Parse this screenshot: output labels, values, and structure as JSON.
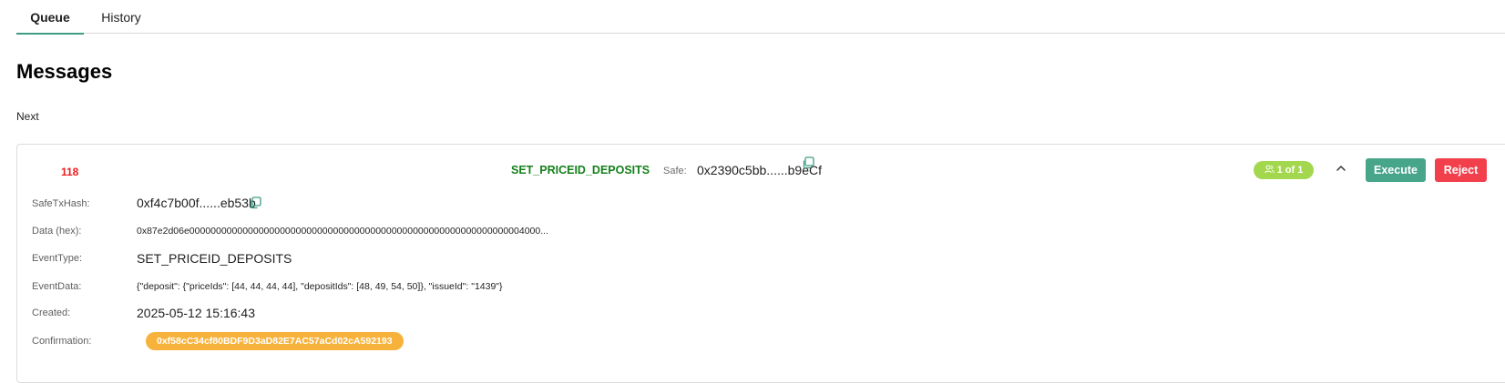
{
  "tabs": {
    "queue": "Queue",
    "history": "History"
  },
  "page": {
    "title": "Messages",
    "section": "Next"
  },
  "message": {
    "nonce": "118",
    "type": "SET_PRICEID_DEPOSITS",
    "safe_label": "Safe:",
    "safe_address": "0x2390c5bb......b9eCf",
    "signers_badge": "1 of 1",
    "execute_label": "Execute",
    "reject_label": "Reject",
    "details": {
      "safe_tx_hash_label": "SafeTxHash:",
      "safe_tx_hash": "0xf4c7b00f......eb53b",
      "data_hex_label": "Data (hex):",
      "data_hex": "0x87e2d06e000000000000000000000000000000000000000000000000000000000000004000...",
      "event_type_label": "EventType:",
      "event_type": "SET_PRICEID_DEPOSITS",
      "event_data_label": "EventData:",
      "event_data": "{\"deposit\": {\"priceIds\": [44, 44, 44, 44], \"depositIds\": [48, 49, 54, 50]}, \"issueId\": \"1439\"}",
      "created_label": "Created:",
      "created": "2025-05-12 15:16:43",
      "confirmation_label": "Confirmation:",
      "confirmation": "0xf58cC34cf80BDF9D3aD82E7AC57aCd02cA592193"
    }
  },
  "icons": {
    "copy": "copy-icon",
    "users": "users-icon",
    "chevron": "chevron-up-icon"
  },
  "colors": {
    "accent": "#3f9c85",
    "nonce": "#ef1b1b",
    "message_type": "#15801b",
    "badge_green": "#a3d84e",
    "execute": "#47a58a",
    "reject": "#f23f4c",
    "confirmation": "#f7b23b"
  }
}
